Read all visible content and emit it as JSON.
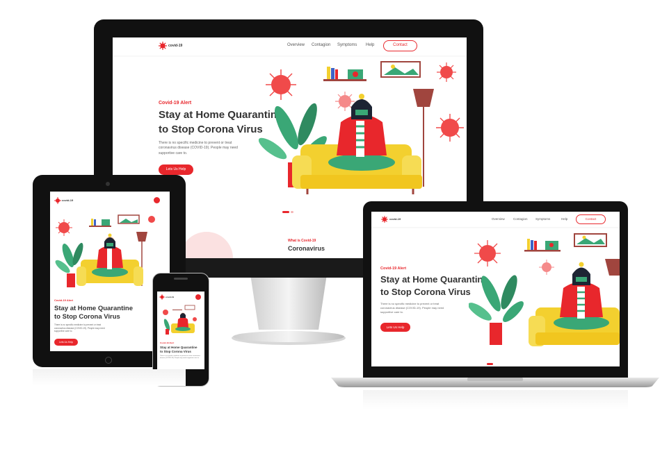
{
  "site": {
    "logo_text": "covid-19",
    "nav": [
      "Overview",
      "Contagion",
      "Symptoms",
      "Help"
    ],
    "contact_label": "Contact",
    "alert_label": "Covid-19 Alert",
    "alert_label_tablet": "Covid-19 Alert",
    "headline_line1": "Stay at Home Quarantine",
    "headline_line2": "to Stop Corona Virus",
    "body": "There is no specific medicine to prevent or treat coronavirus disease (COVID-19). People may need supportive care to.",
    "cta_label": "Lets Us Help",
    "section_kicker": "What is Covid-19",
    "section_title": "Coronavirus"
  },
  "colors": {
    "accent": "#e8272c",
    "plant": "#3aa776",
    "sofa": "#f3d02f",
    "sweater": "#e8272c"
  },
  "icons": [
    "virus-icon",
    "logo-virus-icon",
    "lamp-icon",
    "plant-icon",
    "picture-frame-icon",
    "bookshelf-icon"
  ]
}
